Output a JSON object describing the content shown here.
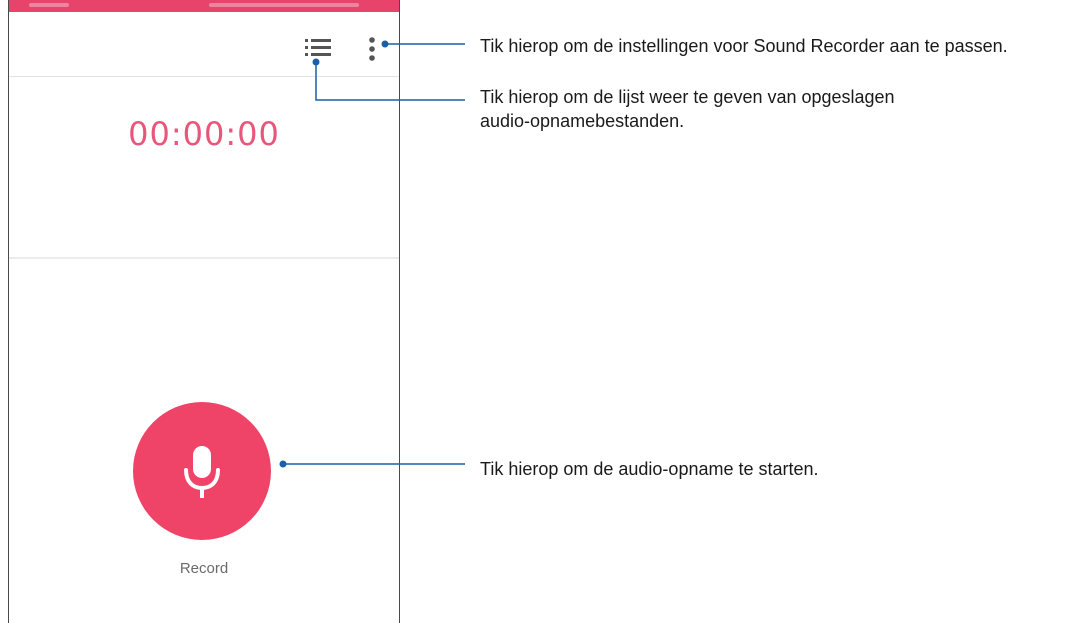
{
  "app": {
    "timer": "00:00:00",
    "record_label": "Record",
    "icons": {
      "list": "list-icon",
      "more": "more-vert-icon",
      "mic": "microphone-icon"
    },
    "colors": {
      "accent": "#ef4468",
      "timer": "#e8577a",
      "status_bar": "#e8436a"
    }
  },
  "callouts": {
    "settings": "Tik hierop om de instellingen voor Sound Recorder aan te passen.",
    "list_line1": "Tik hierop om de lijst weer te geven van opgeslagen",
    "list_line2": "audio-opnamebestanden.",
    "record": "Tik hierop om de audio-opname te starten."
  }
}
